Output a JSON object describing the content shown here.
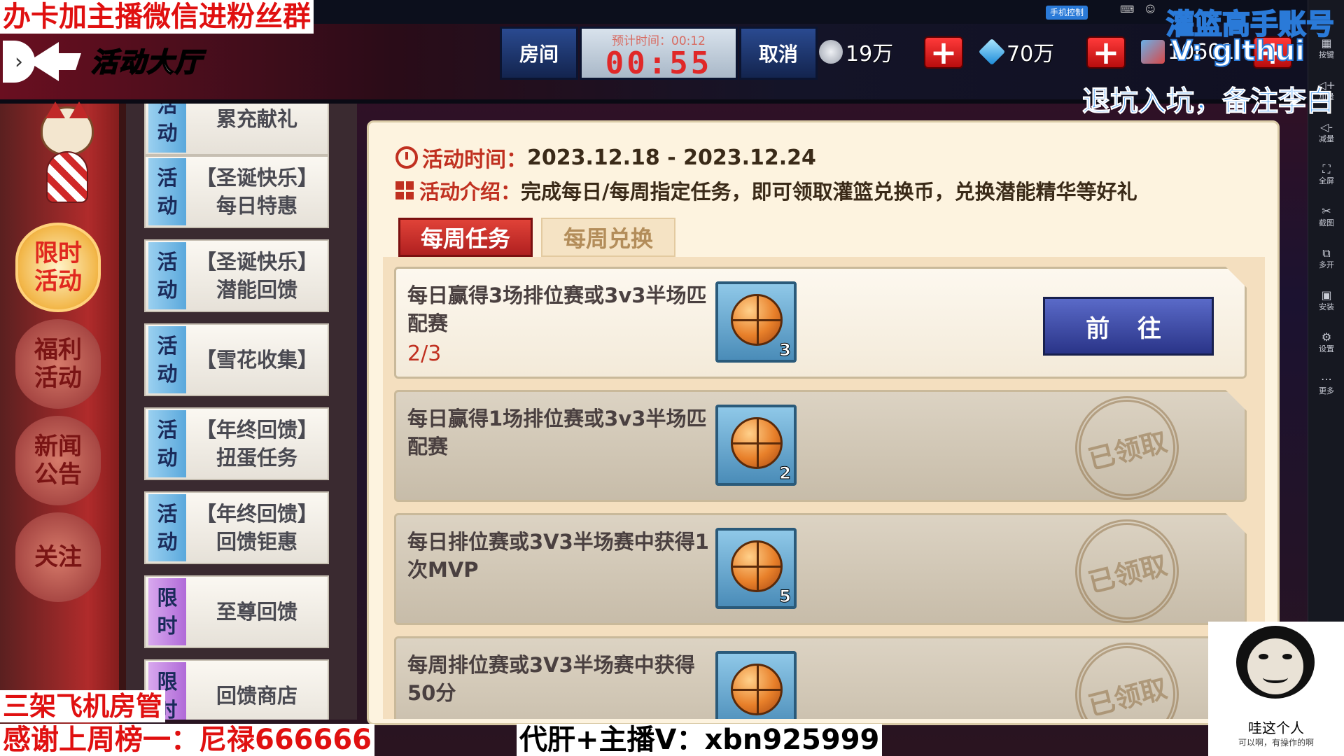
{
  "stream_overlay": {
    "top_left": "办卡加主播微信进粉丝群",
    "top_right_line1": "灌篮高手账号",
    "top_right_line2": "V: glthui",
    "top_right_line3": "退坑入坑，备注李白",
    "bottom_left_line1": "三架飞机房管",
    "bottom_left_line2": "感谢上周榜一：尼禄666666",
    "bottom_center": "代肝+主播V：xbn925999",
    "meme_caption": "哇这个人",
    "meme_subcaption": "可以啊，有操作的啊"
  },
  "emulator": {
    "phone_control_label": "手机控制",
    "toolbar": [
      {
        "icon": "keyboard-icon",
        "label": "按键"
      },
      {
        "icon": "volume-up-icon",
        "label": "加量"
      },
      {
        "icon": "volume-down-icon",
        "label": "减量"
      },
      {
        "icon": "fullscreen-icon",
        "label": "全屏"
      },
      {
        "icon": "scissors-icon",
        "label": "截图"
      },
      {
        "icon": "multi-window-icon",
        "label": "多开"
      },
      {
        "icon": "apk-icon",
        "label": "安装"
      },
      {
        "icon": "settings-icon",
        "label": "设置"
      },
      {
        "icon": "more-icon",
        "label": "更多"
      }
    ]
  },
  "header": {
    "title": "活动大厅",
    "room_button": "房间",
    "cancel_button": "取消",
    "timer_label": "预计时间：00:12",
    "timer_value": "00:55",
    "currency": [
      {
        "name": "coins",
        "value": "19万",
        "icon": "coin-icon",
        "color": "#b8bcc6"
      },
      {
        "name": "diamonds",
        "value": "70万",
        "icon": "diamond-icon",
        "color": "#3ab8f0"
      },
      {
        "name": "tickets",
        "value": "10601",
        "icon": "card-icon",
        "color": "#d84848"
      }
    ],
    "plus_label": "+"
  },
  "left_nav": {
    "items": [
      {
        "label": "限时\n活动",
        "active": true
      },
      {
        "label": "福利\n活动",
        "active": false
      },
      {
        "label": "新闻\n公告",
        "active": false
      },
      {
        "label": "关注",
        "active": false
      }
    ]
  },
  "activity_list": [
    {
      "tag": [
        "活",
        "动"
      ],
      "name": "累充献礼",
      "tag_color": "blue"
    },
    {
      "tag": [
        "活",
        "动"
      ],
      "name": "【圣诞快乐】\n每日特惠",
      "tag_color": "blue"
    },
    {
      "tag": [
        "活",
        "动"
      ],
      "name": "【圣诞快乐】\n潜能回馈",
      "tag_color": "blue"
    },
    {
      "tag": [
        "活",
        "动"
      ],
      "name": "【雪花收集】",
      "tag_color": "blue"
    },
    {
      "tag": [
        "活",
        "动"
      ],
      "name": "【年终回馈】\n扭蛋任务",
      "tag_color": "blue"
    },
    {
      "tag": [
        "活",
        "动"
      ],
      "name": "【年终回馈】\n回馈钜惠",
      "tag_color": "blue"
    },
    {
      "tag": [
        "限",
        "时"
      ],
      "name": "至尊回馈",
      "tag_color": "purple"
    },
    {
      "tag": [
        "限",
        "时"
      ],
      "name": "回馈商店",
      "tag_color": "purple"
    }
  ],
  "detail": {
    "time_label": "活动时间：",
    "time_value": "2023.12.18 - 2023.12.24",
    "desc_label": "活动介绍：",
    "desc_value": "完成每日/每周指定任务，即可领取灌篮兑换币，兑换潜能精华等好礼",
    "tabs": [
      {
        "label": "每周任务",
        "active": true
      },
      {
        "label": "每周兑换",
        "active": false
      }
    ],
    "tasks": [
      {
        "text": "每日赢得3场排位赛或3v3半场匹配赛",
        "progress": "2/3",
        "reward_count": "3",
        "status": "open",
        "button": "前 往"
      },
      {
        "text": "每日赢得1场排位赛或3v3半场匹配赛",
        "progress": "",
        "reward_count": "2",
        "status": "claimed",
        "stamp": "已领取"
      },
      {
        "text": "每日排位赛或3V3半场赛中获得1次MVP",
        "progress": "",
        "reward_count": "5",
        "status": "claimed",
        "stamp": "已领取"
      },
      {
        "text": "每周排位赛或3V3半场赛中获得50分",
        "progress": "",
        "reward_count": "",
        "status": "claimed",
        "stamp": "已领取"
      }
    ]
  }
}
